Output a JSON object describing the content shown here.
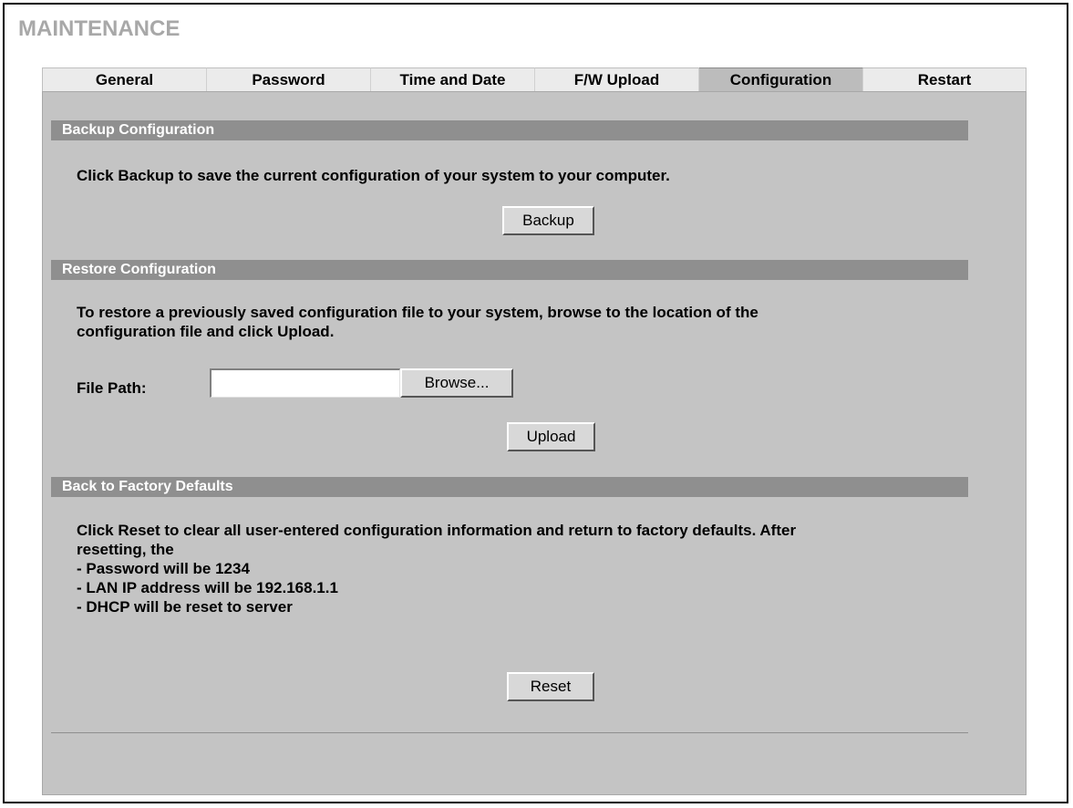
{
  "page": {
    "title": "MAINTENANCE"
  },
  "tabs": [
    {
      "label": "General"
    },
    {
      "label": "Password"
    },
    {
      "label": "Time and Date"
    },
    {
      "label": "F/W Upload"
    },
    {
      "label": "Configuration",
      "active": true
    },
    {
      "label": "Restart"
    }
  ],
  "backup": {
    "header": "Backup Configuration",
    "description": "Click Backup to save the current configuration of your system to your computer.",
    "button_label": "Backup"
  },
  "restore": {
    "header": "Restore Configuration",
    "description_line1": "To restore a previously saved configuration file to your system, browse to the location of the",
    "description_line2": "configuration file and click Upload.",
    "file_path_label": "File Path:",
    "file_path_value": "",
    "browse_label": "Browse...",
    "upload_label": "Upload"
  },
  "factory": {
    "header": "Back to Factory Defaults",
    "description_line1": "Click Reset to clear all user-entered configuration information and return to factory defaults. After",
    "description_line2": "resetting, the",
    "items": [
      "- Password will be 1234",
      "- LAN IP address will be 192.168.1.1",
      "- DHCP will be reset to server"
    ],
    "reset_label": "Reset"
  }
}
